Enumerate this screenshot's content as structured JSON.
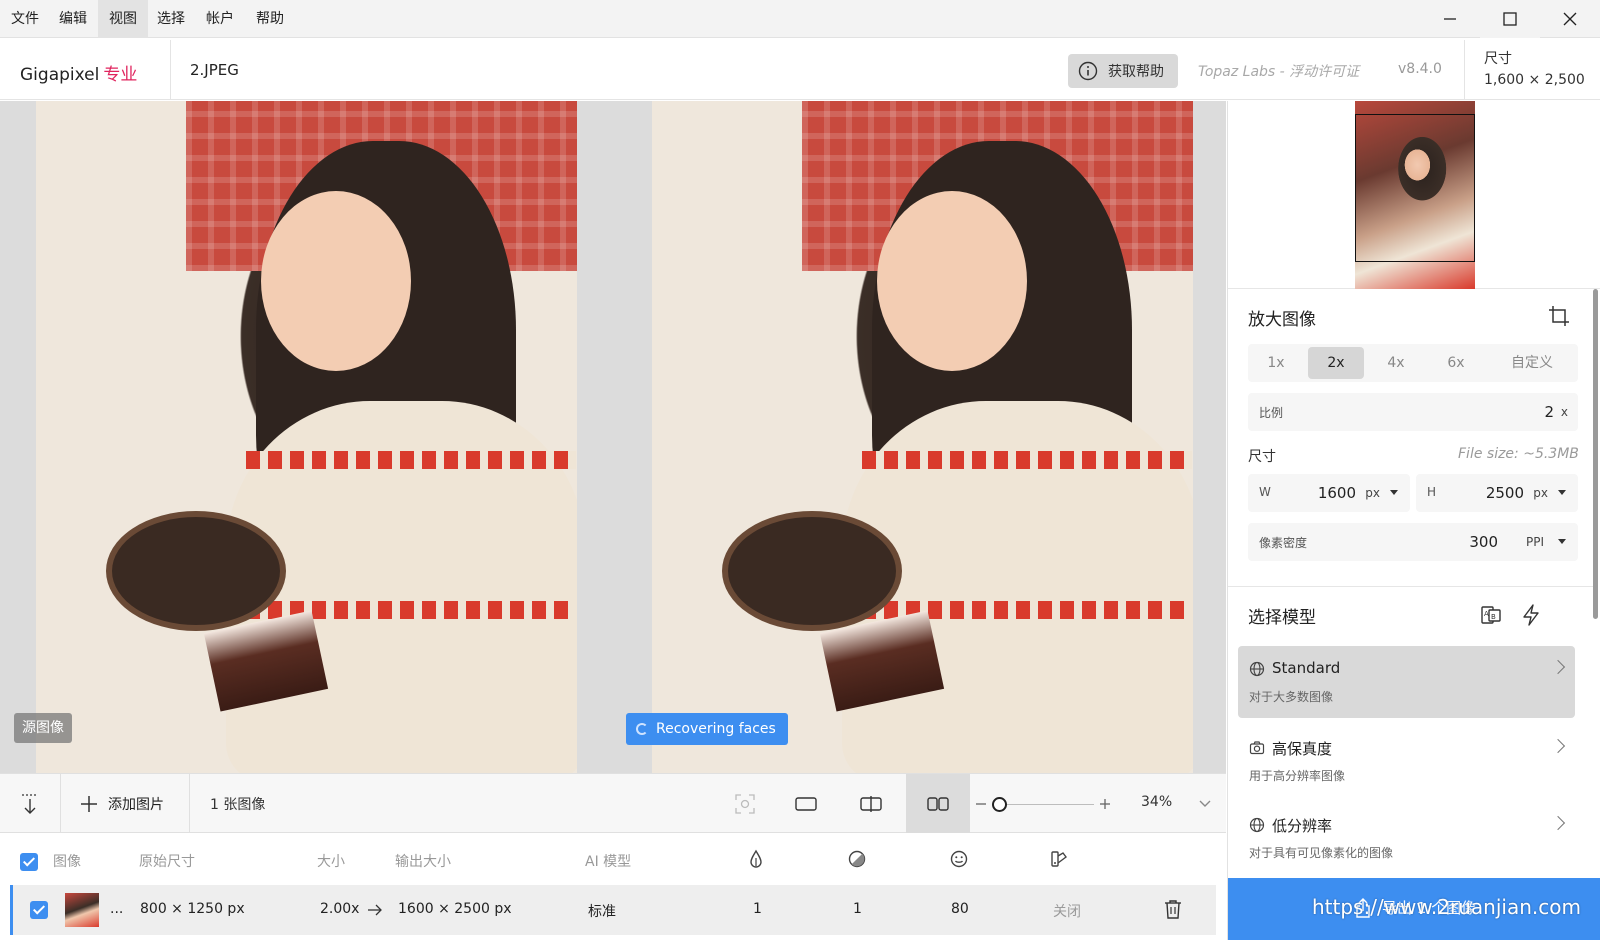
{
  "menu": {
    "items": [
      "文件",
      "编辑",
      "视图",
      "选择",
      "帐户",
      "帮助"
    ],
    "active_index": 2
  },
  "header": {
    "app_name": "Gigapixel",
    "edition": "专业",
    "file_name": "2.JPEG",
    "help_label": "获取帮助",
    "license": "Topaz Labs - 浮动许可证",
    "version": "v8.4.0",
    "size_label": "尺寸",
    "size_value": "1,600 × 2,500"
  },
  "preview": {
    "source_badge": "源图像",
    "status_badge": "Recovering faces"
  },
  "upscale": {
    "title": "放大图像",
    "tabs": [
      "1x",
      "2x",
      "4x",
      "6x",
      "自定义"
    ],
    "active_tab": "2x",
    "ratio_label": "比例",
    "ratio_value": "2",
    "ratio_unit": "x",
    "dimension_label": "尺寸",
    "file_size": "File size: ~5.3MB",
    "width_label": "W",
    "width_value": "1600",
    "width_unit": "px",
    "height_label": "H",
    "height_value": "2500",
    "height_unit": "px",
    "density_label": "像素密度",
    "density_value": "300",
    "density_unit": "PPI"
  },
  "models": {
    "title": "选择模型",
    "items": [
      {
        "name": "Standard",
        "desc": "对于大多数图像",
        "icon": "globe-icon"
      },
      {
        "name": "高保真度",
        "desc": "用于高分辨率图像",
        "icon": "camera-icon"
      },
      {
        "name": "低分辨率",
        "desc": "对于具有可见像素化的图像",
        "icon": "globe-icon"
      }
    ]
  },
  "export": {
    "label": "导出 1 个图像",
    "watermark": "https://www.2ruanjian.com"
  },
  "toolbar": {
    "add_image": "添加图片",
    "image_count": "1 张图像",
    "zoom": "34%"
  },
  "table": {
    "headers": {
      "image": "图像",
      "original_size": "原始尺寸",
      "scale": "大小",
      "output_size": "输出大小",
      "ai_model": "AI 模型"
    },
    "rows": [
      {
        "name": "...",
        "original_size": "800 × 1250 px",
        "scale": "2.00x",
        "output_size": "1600 × 2500 px",
        "model": "标准",
        "denoise": "1",
        "sharpen": "1",
        "face": "80",
        "color": "关闭"
      }
    ]
  },
  "colors": {
    "accent": "#3d8ef0",
    "edition": "#e0245e"
  }
}
